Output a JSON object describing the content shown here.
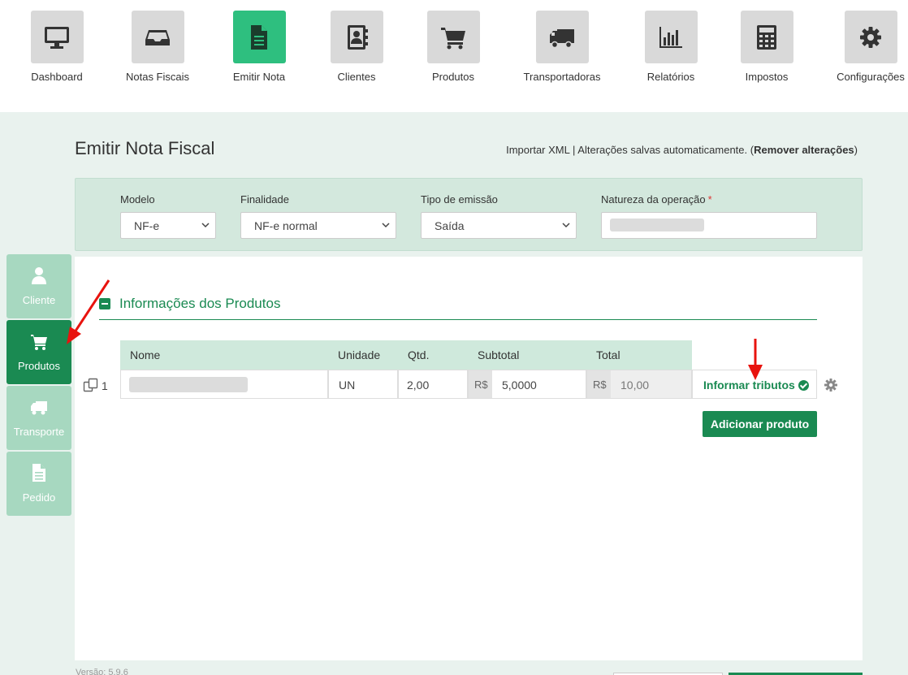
{
  "topnav": {
    "items": [
      {
        "label": "Dashboard",
        "icon": "monitor-icon"
      },
      {
        "label": "Notas Fiscais",
        "icon": "inbox-icon"
      },
      {
        "label": "Emitir Nota",
        "icon": "document-icon",
        "active": true
      },
      {
        "label": "Clientes",
        "icon": "contact-book-icon"
      },
      {
        "label": "Produtos",
        "icon": "cart-icon"
      },
      {
        "label": "Transportadoras",
        "icon": "truck-icon"
      },
      {
        "label": "Relatórios",
        "icon": "bar-chart-icon"
      },
      {
        "label": "Impostos",
        "icon": "calculator-icon"
      },
      {
        "label": "Configurações",
        "icon": "gear-icon"
      }
    ]
  },
  "sidebar": {
    "items": [
      {
        "label": "Cliente",
        "icon": "user-icon"
      },
      {
        "label": "Produtos",
        "icon": "cart-icon",
        "active": true
      },
      {
        "label": "Transporte",
        "icon": "truck-icon"
      },
      {
        "label": "Pedido",
        "icon": "document-icon"
      }
    ]
  },
  "header": {
    "title": "Emitir Nota Fiscal",
    "import_link": "Importar XML",
    "separator": "|",
    "autosave_text": "Alterações salvas automaticamente. (",
    "remove_link": "Remover alterações",
    "close_paren": ")"
  },
  "filters": {
    "modelo": {
      "label": "Modelo",
      "value": "NF-e"
    },
    "finalidade": {
      "label": "Finalidade",
      "value": "NF-e normal"
    },
    "tipo_emissao": {
      "label": "Tipo de emissão",
      "value": "Saída"
    },
    "natureza": {
      "label": "Natureza da operação",
      "required": "*",
      "value": ""
    }
  },
  "products": {
    "section_title": "Informações dos Produtos",
    "columns": {
      "nome": "Nome",
      "unidade": "Unidade",
      "qtd": "Qtd.",
      "subtotal": "Subtotal",
      "total": "Total"
    },
    "rows": [
      {
        "index": "1",
        "nome": "",
        "unidade": "UN",
        "qtd": "2,00",
        "currency": "R$",
        "subtotal": "5,0000",
        "total": "10,00"
      }
    ],
    "tributos_link": "Informar tributos",
    "add_button": "Adicionar produto"
  },
  "footer": {
    "version": "Versão: 5.9.6"
  },
  "colors": {
    "brand_green": "#1a8a52",
    "active_tab": "#2ebf7f",
    "panel_bg": "#d3e8dd",
    "annotation_red": "#e8130e"
  }
}
